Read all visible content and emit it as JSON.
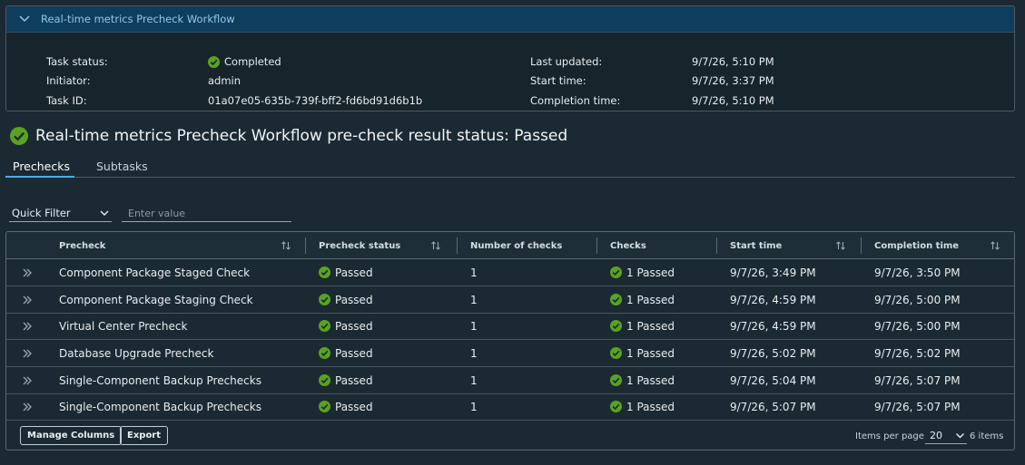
{
  "workflow": {
    "header_title": "Real-time metrics Precheck Workflow",
    "task_status_label": "Task status:",
    "task_status_value": "Completed",
    "initiator_label": "Initiator:",
    "initiator_value": "admin",
    "task_id_label": "Task ID:",
    "task_id_value": "01a07e05-635b-739f-bff2-fd6bd91d6b1b",
    "last_updated_label": "Last updated:",
    "last_updated_value": "9/7/26, 5:10 PM",
    "start_time_label": "Start time:",
    "start_time_value": "9/7/26, 3:37 PM",
    "completion_time_label": "Completion time:",
    "completion_time_value": "9/7/26, 5:10 PM"
  },
  "page_title": "Real-time metrics Precheck Workflow pre-check result status: Passed",
  "tabs": [
    {
      "label": "Prechecks",
      "active": true
    },
    {
      "label": "Subtasks",
      "active": false
    }
  ],
  "filter": {
    "quick_filter_label": "Quick Filter",
    "value_placeholder": "Enter value"
  },
  "table": {
    "columns": [
      "Precheck",
      "Precheck status",
      "Number of checks",
      "Checks",
      "Start time",
      "Completion time"
    ],
    "rows": [
      {
        "precheck": "Component Package Staged Check",
        "status": "Passed",
        "num_checks": "1",
        "checks": "1 Passed",
        "start": "9/7/26, 3:49 PM",
        "completion": "9/7/26, 3:50 PM"
      },
      {
        "precheck": "Component Package Staging Check",
        "status": "Passed",
        "num_checks": "1",
        "checks": "1 Passed",
        "start": "9/7/26, 4:59 PM",
        "completion": "9/7/26, 5:00 PM"
      },
      {
        "precheck": "Virtual Center Precheck",
        "status": "Passed",
        "num_checks": "1",
        "checks": "1 Passed",
        "start": "9/7/26, 4:59 PM",
        "completion": "9/7/26, 5:00 PM"
      },
      {
        "precheck": "Database Upgrade Precheck",
        "status": "Passed",
        "num_checks": "1",
        "checks": "1 Passed",
        "start": "9/7/26, 5:02 PM",
        "completion": "9/7/26, 5:02 PM"
      },
      {
        "precheck": "Single-Component Backup Prechecks",
        "status": "Passed",
        "num_checks": "1",
        "checks": "1 Passed",
        "start": "9/7/26, 5:04 PM",
        "completion": "9/7/26, 5:07 PM"
      },
      {
        "precheck": "Single-Component Backup Prechecks",
        "status": "Passed",
        "num_checks": "1",
        "checks": "1 Passed",
        "start": "9/7/26, 5:07 PM",
        "completion": "9/7/26, 5:07 PM"
      }
    ]
  },
  "footer": {
    "manage_columns_label": "Manage Columns",
    "export_label": "Export",
    "items_per_page_label": "Items per page",
    "items_per_page_value": "20",
    "item_count": "6 items"
  },
  "colors": {
    "success_green": "#5aa220",
    "accent_blue": "#49aeea",
    "header_bar": "#0f3d5c"
  }
}
